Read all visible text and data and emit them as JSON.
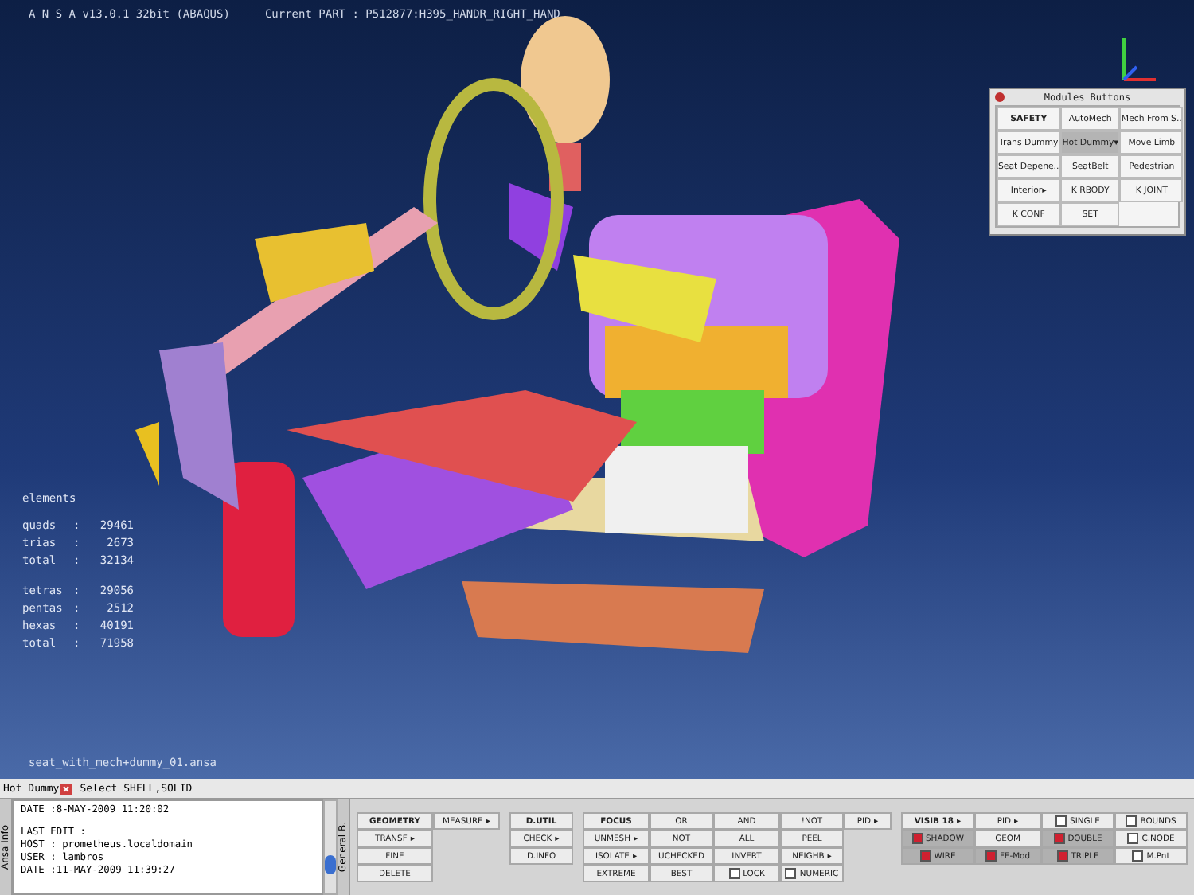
{
  "window": {
    "title": "A N S A  v13.0.1 32bit (ABAQUS)",
    "current_part": "Current PART : P512877:H395_HANDR_RIGHT_HAND"
  },
  "modules_panel": {
    "title": "Modules Buttons",
    "buttons": [
      {
        "label": "SAFETY",
        "selected": true
      },
      {
        "label": "AutoMech",
        "selected": false
      },
      {
        "label": "Mech From S..",
        "selected": false
      },
      {
        "label": "Trans Dummy",
        "selected": false
      },
      {
        "label": "Hot Dummy",
        "selected": true,
        "arrow": "▾"
      },
      {
        "label": "Move Limb",
        "selected": false
      },
      {
        "label": "Seat Depene..",
        "selected": false
      },
      {
        "label": "SeatBelt",
        "selected": false
      },
      {
        "label": "Pedestrian",
        "selected": false
      },
      {
        "label": "Interior",
        "selected": false,
        "arrow": "▸"
      },
      {
        "label": "K RBODY",
        "selected": false
      },
      {
        "label": "K JOINT",
        "selected": false
      },
      {
        "label": "K CONF",
        "selected": false
      },
      {
        "label": "SET",
        "selected": false
      }
    ]
  },
  "statistics": {
    "heading": "elements",
    "groups": [
      [
        {
          "label": "quads",
          "separator": ":",
          "value": "29461"
        },
        {
          "label": "trias",
          "separator": ":",
          "value": "2673"
        },
        {
          "label": "total",
          "separator": ":",
          "value": "32134"
        }
      ],
      [
        {
          "label": "tetras",
          "separator": ":",
          "value": "29056"
        },
        {
          "label": "pentas",
          "separator": ":",
          "value": "2512"
        },
        {
          "label": "hexas",
          "separator": ":",
          "value": "40191"
        },
        {
          "label": "total",
          "separator": ":",
          "value": "71958"
        }
      ]
    ]
  },
  "file_name": "seat_with_mech+dummy_01.ansa",
  "status_bar": {
    "mode": "Hot Dummy",
    "prompt": "Select SHELL,SOLID"
  },
  "info_panel": {
    "tab": "Ansa Info",
    "blocks": [
      [
        "DATE :8-MAY-2009  11:20:02"
      ],
      [
        "LAST EDIT :",
        "HOST : prometheus.localdomain",
        "USER : lambros",
        "DATE :11-MAY-2009  11:39:27"
      ]
    ]
  },
  "button_panel": {
    "tab": "General B.",
    "groups": [
      {
        "kind": "geometry",
        "cells": [
          {
            "kind": "header",
            "label": "GEOMETRY"
          },
          {
            "kind": "button",
            "label": "MEASURE",
            "arrow": "▸"
          },
          {
            "kind": "button",
            "label": "TRANSF",
            "arrow": "▸"
          },
          {
            "kind": "empty"
          },
          {
            "kind": "button",
            "label": "FINE"
          },
          {
            "kind": "empty"
          },
          {
            "kind": "button",
            "label": "DELETE"
          }
        ]
      },
      {
        "kind": "utility",
        "cells": [
          {
            "kind": "header",
            "label": "D.UTIL"
          },
          {
            "kind": "button",
            "label": "CHECK",
            "arrow": "▸"
          },
          {
            "kind": "button",
            "label": "D.INFO"
          }
        ]
      },
      {
        "kind": "focus",
        "cells": [
          {
            "kind": "header",
            "label": "FOCUS"
          },
          {
            "kind": "button",
            "label": "OR"
          },
          {
            "kind": "button",
            "label": "AND"
          },
          {
            "kind": "button",
            "label": "!NOT"
          },
          {
            "kind": "button",
            "label": "PID",
            "arrow": "▸"
          },
          {
            "kind": "button",
            "label": "UNMESH",
            "arrow": "▸"
          },
          {
            "kind": "button",
            "label": "NOT"
          },
          {
            "kind": "button",
            "label": "ALL"
          },
          {
            "kind": "button",
            "label": "PEEL"
          },
          {
            "kind": "empty"
          },
          {
            "kind": "button",
            "label": "ISOLATE",
            "arrow": "▸"
          },
          {
            "kind": "button",
            "label": "UCHECKED"
          },
          {
            "kind": "button",
            "label": "INVERT"
          },
          {
            "kind": "button",
            "label": "NEIGHB",
            "arrow": "▸"
          },
          {
            "kind": "empty"
          },
          {
            "kind": "button",
            "label": "EXTREME"
          },
          {
            "kind": "button",
            "label": "BEST"
          },
          {
            "kind": "checkbox",
            "label": "LOCK",
            "checked": false
          },
          {
            "kind": "checkbox",
            "label": "NUMERIC",
            "checked": false
          }
        ]
      },
      {
        "kind": "visibility",
        "cells": [
          {
            "kind": "header",
            "label": "VISIB 18",
            "arrow": "▸"
          },
          {
            "kind": "button",
            "label": "PID",
            "arrow": "▸"
          },
          {
            "kind": "checkbox",
            "label": "SINGLE",
            "checked": false
          },
          {
            "kind": "checkbox",
            "label": "BOUNDS",
            "checked": false
          },
          {
            "kind": "checkbox",
            "label": "SHADOW",
            "checked": true
          },
          {
            "kind": "button",
            "label": "GEOM"
          },
          {
            "kind": "checkbox",
            "label": "DOUBLE",
            "checked": true
          },
          {
            "kind": "checkbox",
            "label": "C.NODE",
            "checked": false
          },
          {
            "kind": "checkbox",
            "label": "WIRE",
            "checked": true
          },
          {
            "kind": "checkbox",
            "label": "FE-Mod",
            "checked": true
          },
          {
            "kind": "checkbox",
            "label": "TRIPLE",
            "checked": true
          },
          {
            "kind": "checkbox",
            "label": "M.Pnt",
            "checked": false
          }
        ]
      }
    ]
  }
}
